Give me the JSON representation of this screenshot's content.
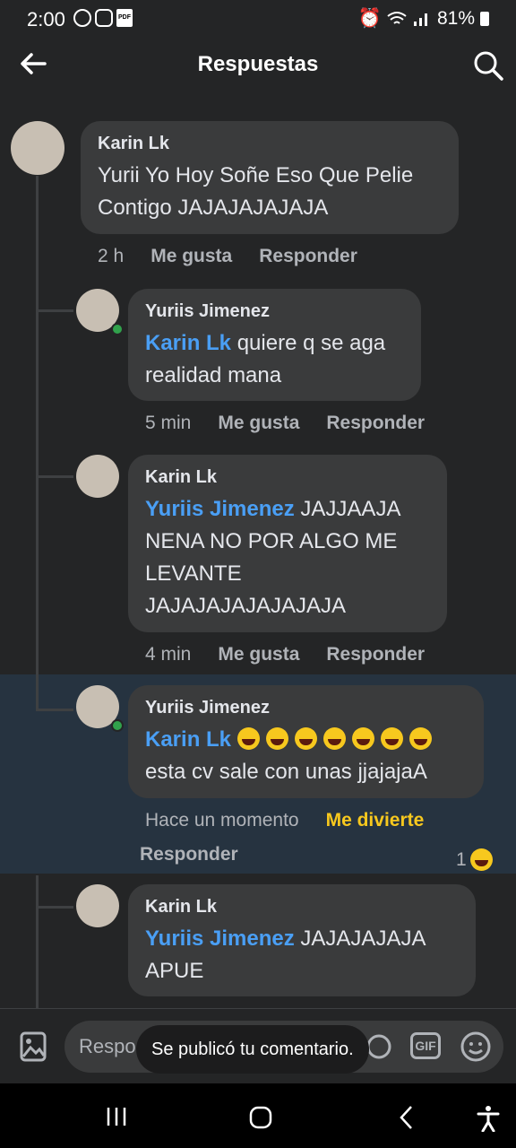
{
  "status_bar": {
    "time": "2:00",
    "battery": "81%",
    "pdf_label": "PDF"
  },
  "header": {
    "title": "Respuestas"
  },
  "comments": [
    {
      "author": "Karin Lk",
      "text": "Yurii Yo Hoy Soñe Eso Que Pelie Contigo JAJAJAJAJAJA",
      "time": "2 h",
      "like": "Me gusta",
      "reply": "Responder"
    },
    {
      "author": "Yuriis Jimenez",
      "mention": "Karin Lk",
      "text": " quiere q se aga realidad mana",
      "time": "5 min",
      "like": "Me gusta",
      "reply": "Responder"
    },
    {
      "author": "Karin Lk",
      "mention": "Yuriis Jimenez",
      "text": " JAJJAAJA NENA NO POR ALGO ME LEVANTE JAJAJAJAJAJAJAJA",
      "time": "4 min",
      "like": "Me gusta",
      "reply": "Responder"
    },
    {
      "author": "Yuriis Jimenez",
      "mention": "Karin Lk",
      "text": "esta cv sale con unas jjajajaA",
      "emoji_count": 7,
      "time": "Hace un momento",
      "like": "Me divierte",
      "reply": "Responder",
      "reaction_count": "1"
    },
    {
      "author": "Karin Lk",
      "mention": "Yuriis Jimenez",
      "text": " JAJAJAJAJA APUE"
    }
  ],
  "composer": {
    "placeholder": "Respo",
    "gif_label": "GIF",
    "toast": "Se publicó tu comentario."
  },
  "colors": {
    "background": "#242526",
    "bubble": "#3a3b3c",
    "mention": "#4a9ff5",
    "highlight": "#263340",
    "reaction": "#f7c81e"
  }
}
